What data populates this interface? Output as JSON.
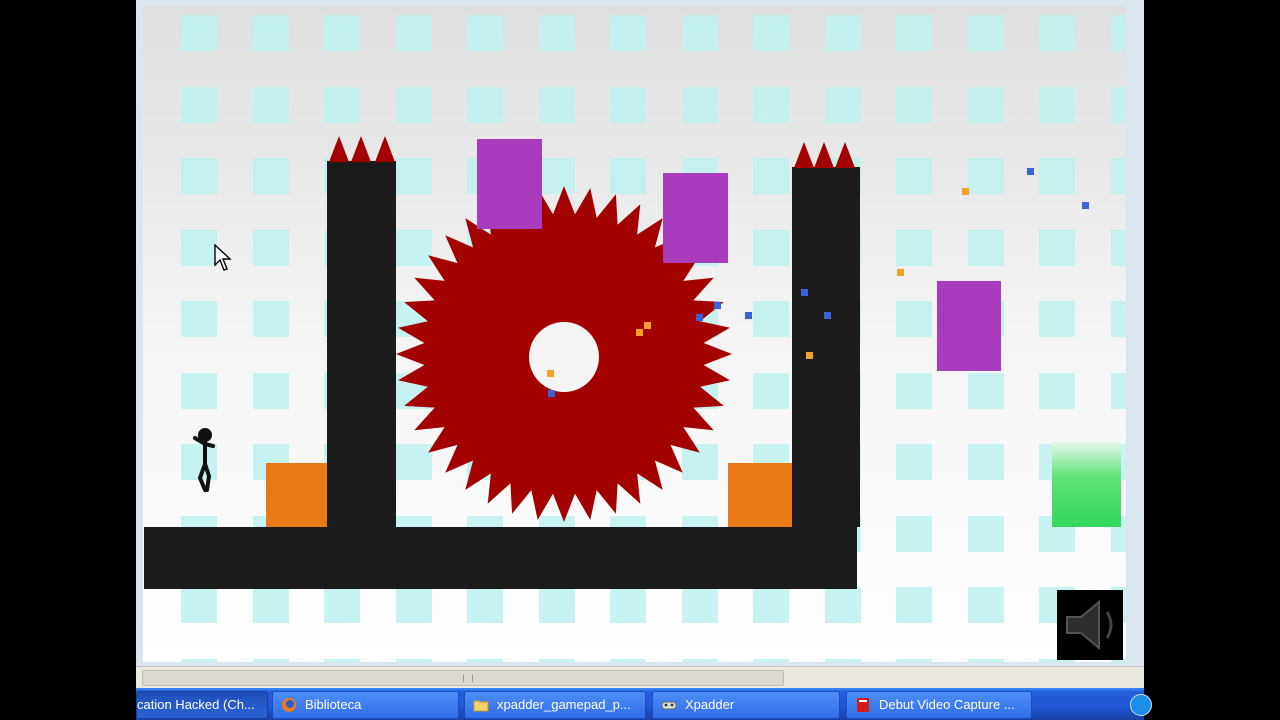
{
  "window": {
    "title": ""
  },
  "taskbar": {
    "tasks": [
      {
        "label": "cation Hacked (Ch...",
        "icon": "app-icon"
      },
      {
        "label": "Biblioteca",
        "icon": "firefox-icon"
      },
      {
        "label": "xpadder_gamepad_p...",
        "icon": "folder-icon"
      },
      {
        "label": "Xpadder",
        "icon": "gamepad-icon"
      },
      {
        "label": "Debut Video Capture ...",
        "icon": "debut-icon"
      }
    ]
  },
  "game": {
    "colors": {
      "wall": "#1b1b1b",
      "saw": "#a30000",
      "crate": "#e77a17",
      "moving_block": "#a93bbd",
      "exit": "#34d65a",
      "tile": "#bdf2f1"
    }
  },
  "icons": {
    "cursor": "arrow-cursor-icon",
    "sound": "speaker-icon"
  }
}
